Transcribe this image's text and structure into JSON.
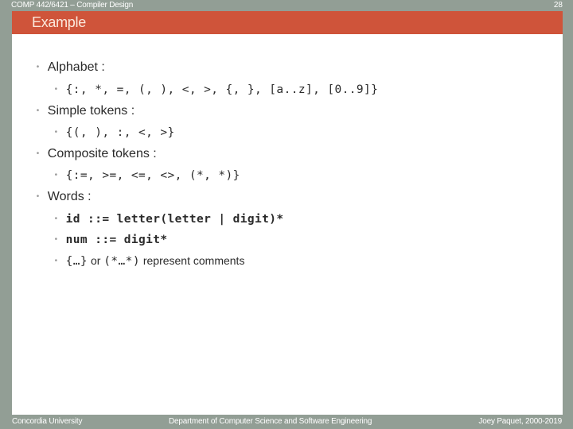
{
  "header": {
    "course": "COMP 442/6421 – Compiler Design",
    "page_number": "28",
    "title": "Example"
  },
  "body": {
    "alphabet_label": "Alphabet :",
    "alphabet_value": "{:, *, =, (, ), <, >, {, }, [a..z], [0..9]}",
    "simple_label": "Simple tokens :",
    "simple_value": "{(, ), :, <, >}",
    "composite_label": "Composite tokens :",
    "composite_value": "{:=, >=, <=, <>, (*, *)}",
    "words_label": "Words :",
    "words_id": "id ::= letter(letter | digit)*",
    "words_num": "num ::= digit*",
    "comments_open": "{…}",
    "comments_or": " or ",
    "comments_paren": "(*…*)",
    "comments_text": " represent comments"
  },
  "footer": {
    "left": "Concordia University",
    "center": "Department of Computer Science and Software Engineering",
    "right": "Joey Paquet, 2000-2019"
  },
  "colors": {
    "frame": "#929e95",
    "header_bar": "#cf543a",
    "content_bg": "#ffffff"
  }
}
